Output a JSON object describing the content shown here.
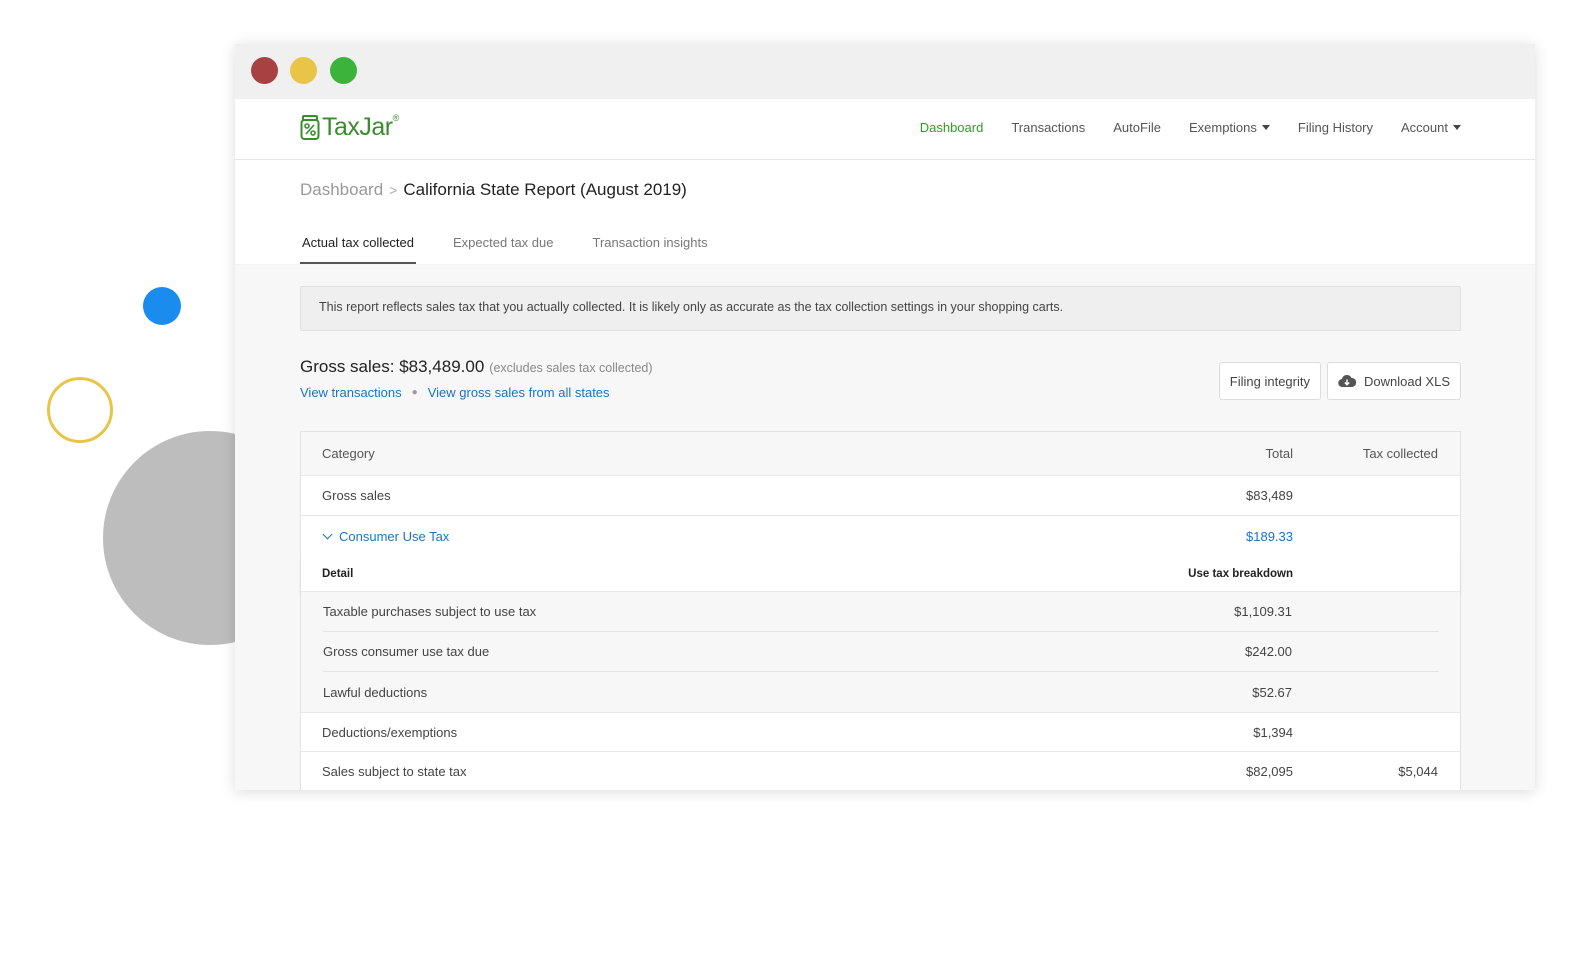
{
  "window_controls": [
    "close",
    "minimize",
    "maximize"
  ],
  "brand": {
    "name": "TaxJar",
    "trademark": "®",
    "color": "#3a8c2e"
  },
  "nav": {
    "items": [
      {
        "label": "Dashboard",
        "active": true
      },
      {
        "label": "Transactions"
      },
      {
        "label": "AutoFile"
      },
      {
        "label": "Exemptions",
        "dropdown": true
      },
      {
        "label": "Filing History"
      },
      {
        "label": "Account",
        "dropdown": true
      }
    ]
  },
  "breadcrumb": {
    "parent": "Dashboard",
    "separator": ">",
    "current": "California State Report (August 2019)"
  },
  "tabs": [
    {
      "label": "Actual tax collected",
      "active": true
    },
    {
      "label": "Expected tax due"
    },
    {
      "label": "Transaction insights"
    }
  ],
  "notice": "This report reflects sales tax that you actually collected. It is likely only as accurate as the tax collection settings in your shopping carts.",
  "summary": {
    "gross_label": "Gross sales: $83,489.00",
    "gross_note": "(excludes sales tax collected)",
    "link_transactions": "View transactions",
    "link_all_states": "View gross sales from all states",
    "filing_integrity": "Filing integrity",
    "download": "Download XLS"
  },
  "table": {
    "headers": {
      "category": "Category",
      "total": "Total",
      "tax": "Tax collected"
    },
    "gross_sales": {
      "category": "Gross sales",
      "total": "$83,489",
      "tax": ""
    },
    "consumer_use": {
      "category": "Consumer Use Tax",
      "total": "$189.33",
      "detail_label": "Detail",
      "breakdown_label": "Use tax breakdown",
      "rows": [
        {
          "category": "Taxable purchases subject to use tax",
          "total": "$1,109.31"
        },
        {
          "category": "Gross consumer use tax due",
          "total": "$242.00"
        },
        {
          "category": "Lawful deductions",
          "total": "$52.67"
        }
      ]
    },
    "deductions": {
      "category": "Deductions/exemptions",
      "total": "$1,394",
      "tax": ""
    },
    "sales_subject": {
      "category": "Sales subject to state tax",
      "total": "$82,095",
      "tax": "$5,044"
    }
  }
}
